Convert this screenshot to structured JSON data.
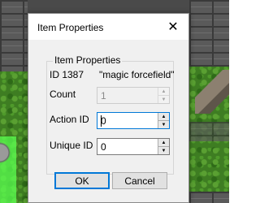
{
  "dialog": {
    "title": "Item Properties",
    "close_glyph": "✕",
    "group_title": "Item Properties",
    "id_text": "ID 1387",
    "item_name": "\"magic forcefield\"",
    "fields": {
      "count": {
        "label": "Count",
        "value": "1",
        "enabled": false
      },
      "action_id": {
        "label": "Action ID",
        "value": "0",
        "enabled": true,
        "focused": true
      },
      "unique_id": {
        "label": "Unique ID",
        "value": "0",
        "enabled": true
      }
    },
    "buttons": {
      "ok": "OK",
      "cancel": "Cancel"
    }
  },
  "spin_glyphs": {
    "up": "▲",
    "down": "▼"
  },
  "colors": {
    "dialog_bg": "#f0f0f0",
    "focus_border": "#0078d7",
    "selection": "#5aff50"
  }
}
